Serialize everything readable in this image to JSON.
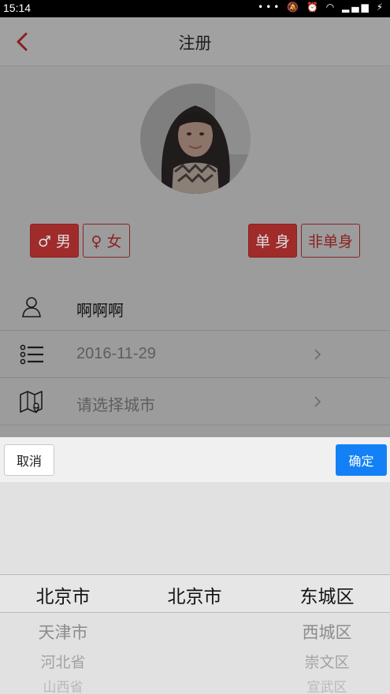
{
  "status_bar": {
    "time": "15:14",
    "icons": [
      "more-dots-icon",
      "mute-icon",
      "alarm-icon",
      "wifi-icon",
      "signal-icon",
      "battery-icon"
    ]
  },
  "header": {
    "title": "注册",
    "back_icon": "chevron-left-icon"
  },
  "profile": {
    "gender": {
      "male": "♂ 男",
      "female": "♀ 女",
      "selected": "male"
    },
    "relationship": {
      "single": "单 身",
      "not_single": "非单身",
      "selected": "single"
    },
    "name": {
      "icon": "user-icon",
      "value": "啊啊啊"
    },
    "birthday": {
      "icon": "list-icon",
      "value": "2016-11-29"
    },
    "city": {
      "icon": "map-icon",
      "placeholder": "请选择城市"
    }
  },
  "picker": {
    "cancel_label": "取消",
    "confirm_label": "确定",
    "provinces": [
      "北京市",
      "天津市",
      "河北省",
      "山西省"
    ],
    "cities": [
      "北京市"
    ],
    "districts": [
      "东城区",
      "西城区",
      "崇文区",
      "宣武区"
    ]
  },
  "colors": {
    "accent_red": "#c43a3a",
    "confirm_blue": "#1381f5",
    "overlay": "rgba(0,0,0,0.4)"
  }
}
